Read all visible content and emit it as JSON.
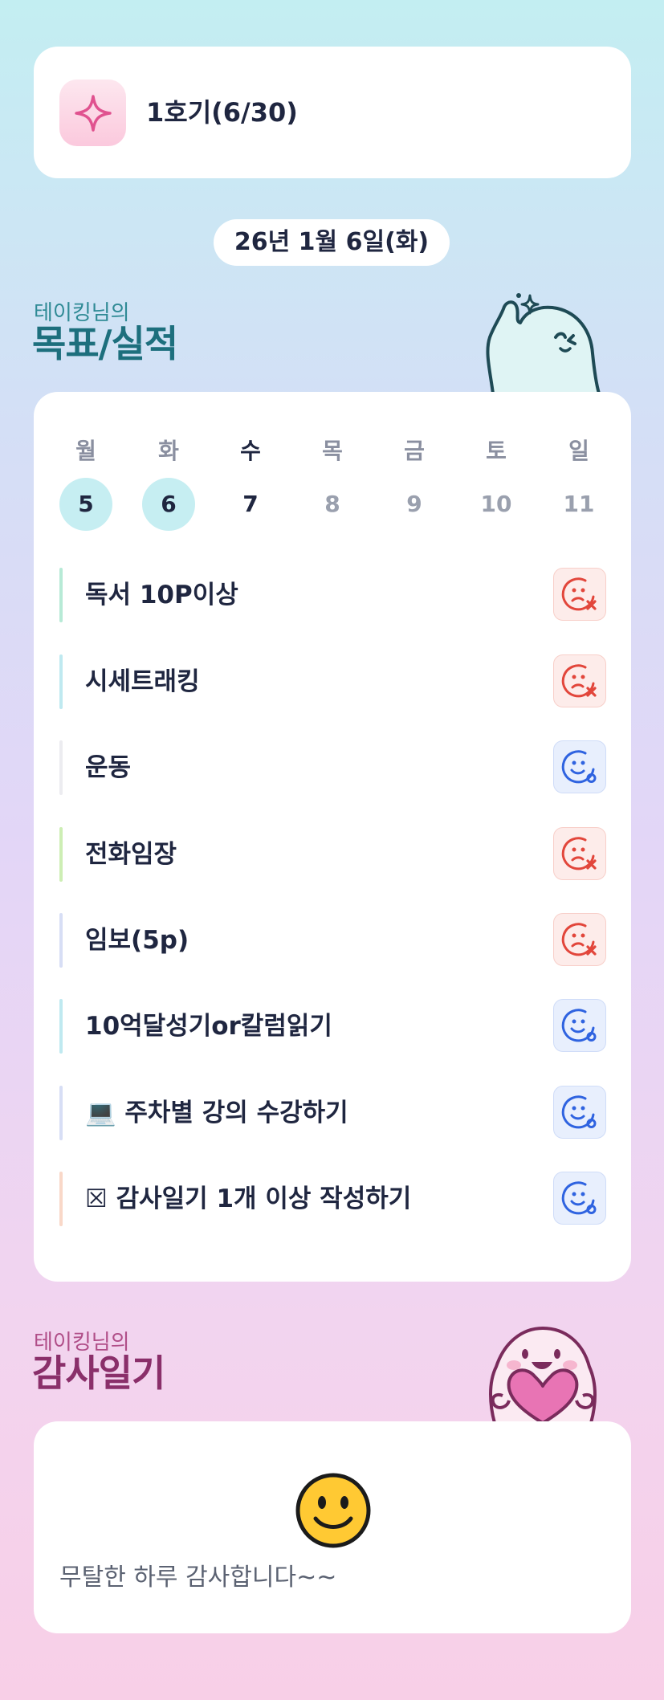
{
  "batch": {
    "title": "1호기(6/30)",
    "icon": "sparkle-icon"
  },
  "date_pill": "26년 1월 6일(화)",
  "goals_section": {
    "subtitle": "테이킹님의",
    "title": "목표/실적"
  },
  "week": [
    {
      "label": "월",
      "num": "5",
      "state": "done"
    },
    {
      "label": "화",
      "num": "6",
      "state": "done"
    },
    {
      "label": "수",
      "num": "7",
      "state": "today"
    },
    {
      "label": "목",
      "num": "8",
      "state": "future"
    },
    {
      "label": "금",
      "num": "9",
      "state": "future"
    },
    {
      "label": "토",
      "num": "10",
      "state": "future"
    },
    {
      "label": "일",
      "num": "11",
      "state": "future"
    }
  ],
  "goals": [
    {
      "text": "독서 10P이상",
      "status": "fail",
      "bar_color": "#b7ead6"
    },
    {
      "text": "시세트래킹",
      "status": "fail",
      "bar_color": "#bfe9f0"
    },
    {
      "text": "운동",
      "status": "ok",
      "bar_color": "#ececf0"
    },
    {
      "text": "전화임장",
      "status": "fail",
      "bar_color": "#cdeeb4"
    },
    {
      "text": "임보(5p)",
      "status": "fail",
      "bar_color": "#d7def5"
    },
    {
      "text": "10억달성기or칼럼읽기",
      "status": "ok",
      "bar_color": "#bfe9f0"
    },
    {
      "text": "💻 주차별 강의 수강하기",
      "status": "ok",
      "bar_color": "#d7def5"
    },
    {
      "text": "☒ 감사일기 1개 이상 작성하기",
      "status": "ok",
      "bar_color": "#f9d8c8"
    }
  ],
  "status_icons": {
    "fail": "sad-face-x-icon",
    "ok": "smile-face-o-icon"
  },
  "colors": {
    "fail": "#e2463b",
    "ok": "#2f63e0",
    "goals_title": "#1d6f7d",
    "thanks_title": "#8a2f6a"
  },
  "thanks_section": {
    "subtitle": "테이킹님의",
    "title": "감사일기"
  },
  "thanks_entry": {
    "emoji": "slightly-smiling-face-icon",
    "text": "무탈한 하루 감사합니다~~"
  }
}
